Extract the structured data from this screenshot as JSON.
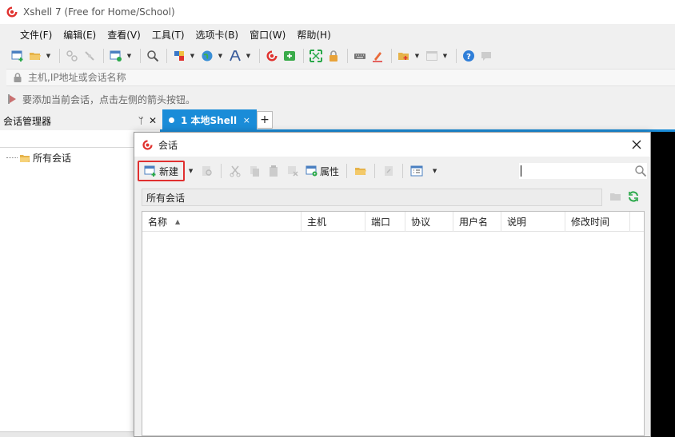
{
  "app": {
    "title": "Xshell 7 (Free for Home/School)",
    "accent": "#1a8cd8"
  },
  "menu": [
    "文件(F)",
    "编辑(E)",
    "查看(V)",
    "工具(T)",
    "选项卡(B)",
    "窗口(W)",
    "帮助(H)"
  ],
  "address": {
    "placeholder": "主机,IP地址或会话名称"
  },
  "hint": {
    "text": "要添加当前会话，点击左侧的箭头按钮。"
  },
  "session_manager": {
    "title": "会话管理器",
    "pin": "ᛘ",
    "close": "✕",
    "tree": [
      {
        "label": "所有会话"
      }
    ]
  },
  "tabs": [
    {
      "label": "1 本地Shell",
      "active": true,
      "close": "×"
    }
  ],
  "tab_add": "+",
  "dialog": {
    "title": "会话",
    "toolbar": {
      "new_label": "新建",
      "properties_label": "属性"
    },
    "path": "所有会话",
    "columns": [
      {
        "label": "名称",
        "sort": "▲"
      },
      {
        "label": "主机"
      },
      {
        "label": "端口"
      },
      {
        "label": "协议"
      },
      {
        "label": "用户名"
      },
      {
        "label": "说明"
      },
      {
        "label": "修改时间"
      }
    ]
  }
}
